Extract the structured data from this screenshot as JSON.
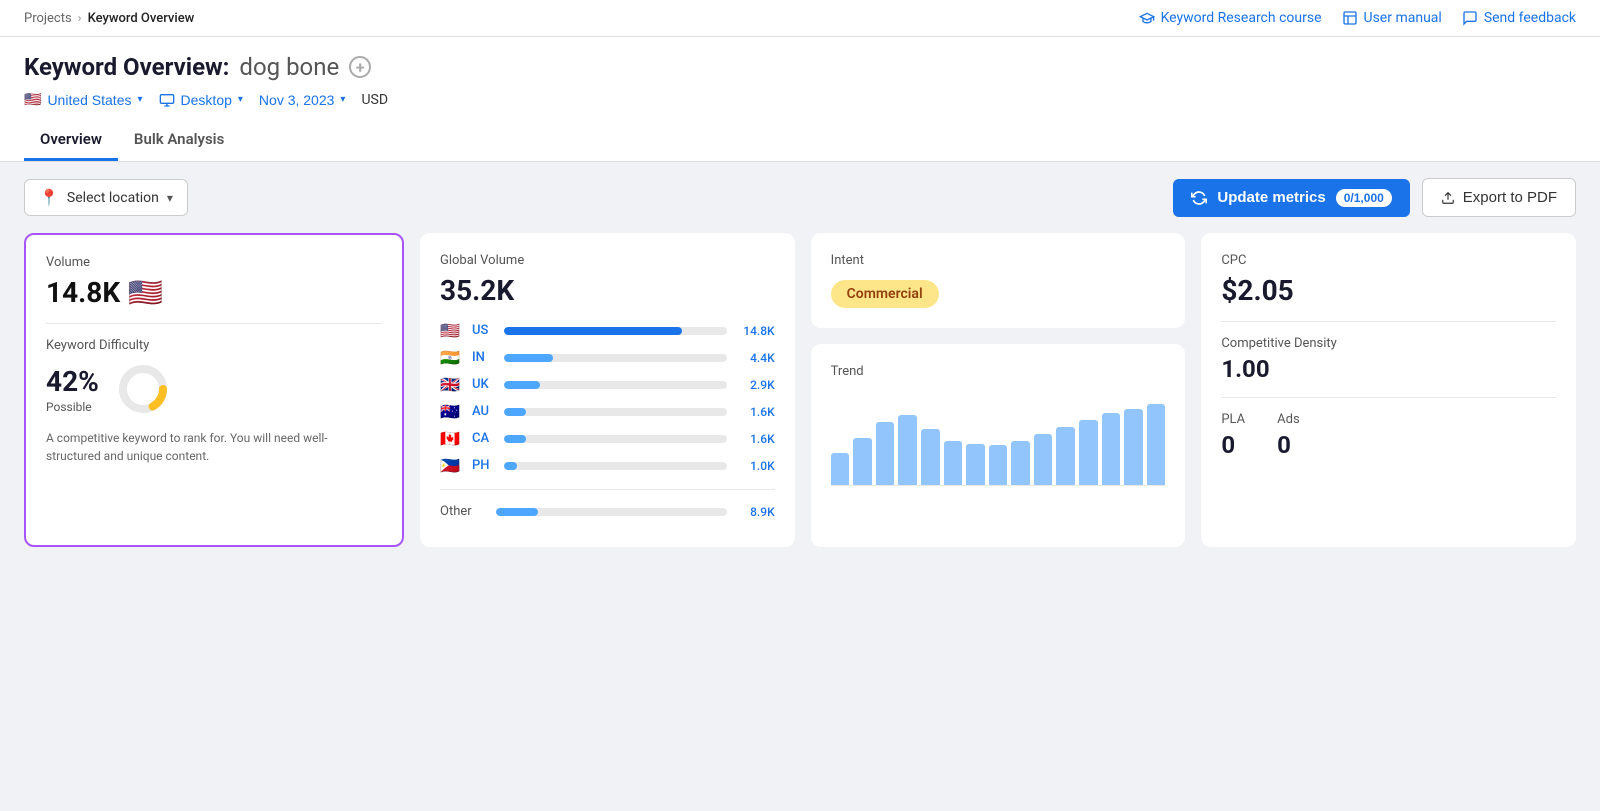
{
  "breadcrumb": {
    "parent": "Projects",
    "current": "Keyword Overview"
  },
  "topLinks": [
    {
      "id": "keyword-course",
      "icon": "graduation-cap",
      "label": "Keyword Research course"
    },
    {
      "id": "user-manual",
      "icon": "book",
      "label": "User manual"
    },
    {
      "id": "send-feedback",
      "icon": "chat",
      "label": "Send feedback"
    }
  ],
  "pageTitle": {
    "prefix": "Keyword Overview:",
    "keyword": "dog bone"
  },
  "filters": {
    "country": "United States",
    "device": "Desktop",
    "date": "Nov 3, 2023",
    "currency": "USD"
  },
  "tabs": [
    {
      "id": "overview",
      "label": "Overview",
      "active": true
    },
    {
      "id": "bulk-analysis",
      "label": "Bulk Analysis",
      "active": false
    }
  ],
  "toolbar": {
    "locationPlaceholder": "Select location",
    "updateBtn": "Update metrics",
    "counter": "0/1,000",
    "exportBtn": "Export to PDF"
  },
  "cards": {
    "volume": {
      "label": "Volume",
      "value": "14.8K"
    },
    "keywordDifficulty": {
      "label": "Keyword Difficulty",
      "percentage": "42%",
      "sublabel": "Possible",
      "description": "A competitive keyword to rank for. You will need well-structured and unique content.",
      "filledPercent": 42
    },
    "globalVolume": {
      "label": "Global Volume",
      "value": "35.2K",
      "countries": [
        {
          "flag": "🇺🇸",
          "code": "US",
          "bar": 80,
          "dark": true,
          "value": "14.8K"
        },
        {
          "flag": "🇮🇳",
          "code": "IN",
          "bar": 22,
          "dark": false,
          "value": "4.4K"
        },
        {
          "flag": "🇬🇧",
          "code": "UK",
          "bar": 16,
          "dark": false,
          "value": "2.9K"
        },
        {
          "flag": "🇦🇺",
          "code": "AU",
          "bar": 10,
          "dark": false,
          "value": "1.6K"
        },
        {
          "flag": "🇨🇦",
          "code": "CA",
          "bar": 10,
          "dark": false,
          "value": "1.6K"
        },
        {
          "flag": "🇵🇭",
          "code": "PH",
          "bar": 6,
          "dark": false,
          "value": "1.0K"
        }
      ],
      "other": {
        "label": "Other",
        "bar": 15,
        "value": "8.9K"
      }
    },
    "intent": {
      "label": "Intent",
      "badge": "Commercial"
    },
    "trend": {
      "label": "Trend",
      "bars": [
        28,
        40,
        55,
        60,
        48,
        38,
        36,
        34,
        38,
        44,
        50,
        56,
        62,
        65,
        70
      ]
    },
    "cpc": {
      "label": "CPC",
      "value": "$2.05"
    },
    "competitiveDensity": {
      "label": "Competitive Density",
      "value": "1.00"
    },
    "pla": {
      "label": "PLA",
      "value": "0"
    },
    "ads": {
      "label": "Ads",
      "value": "0"
    }
  },
  "colors": {
    "accent": "#1a73e8",
    "purple": "#a855f7",
    "yellow": "#fde68a",
    "barBlue": "#4da6ff",
    "barDark": "#1a5bbf",
    "trendBar": "#93c5fd"
  }
}
